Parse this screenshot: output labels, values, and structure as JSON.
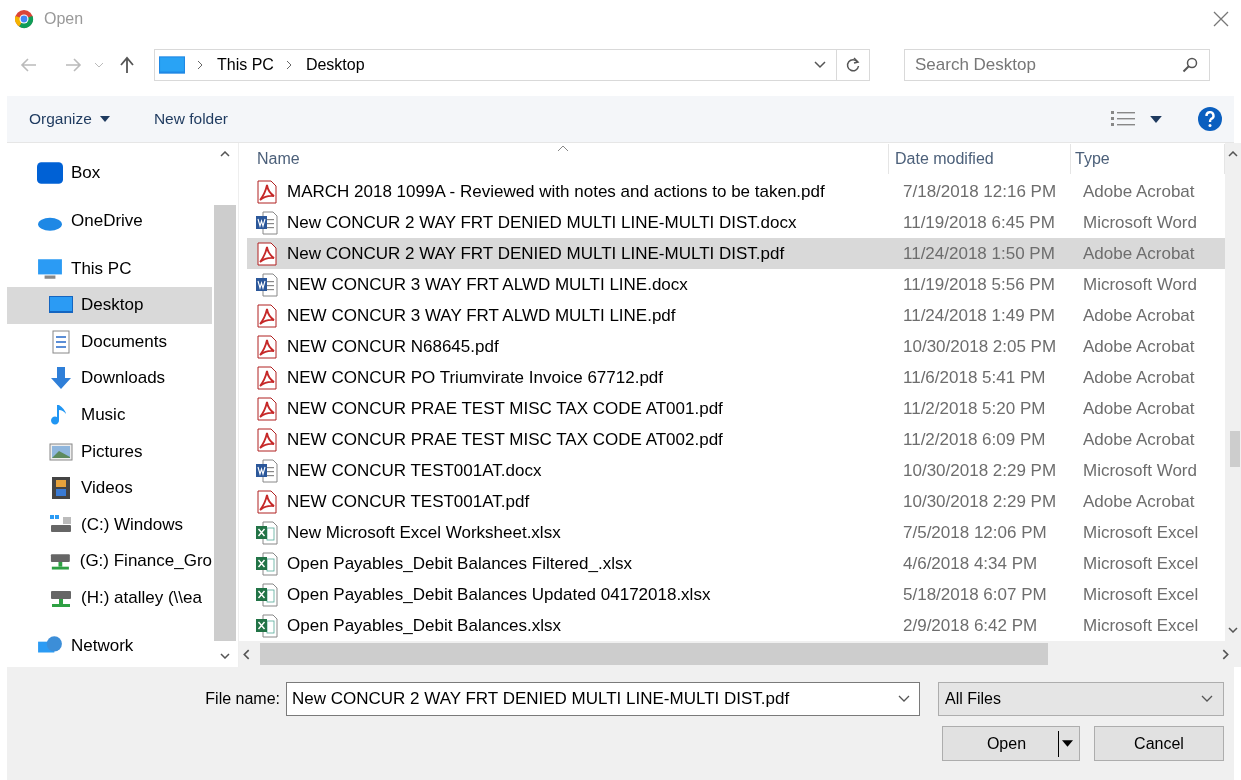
{
  "window": {
    "title": "Open"
  },
  "address": {
    "path": [
      "This PC",
      "Desktop"
    ]
  },
  "search": {
    "placeholder": "Search Desktop"
  },
  "toolbar": {
    "organize": "Organize",
    "new_folder": "New folder"
  },
  "sidebar": {
    "items": [
      {
        "label": "Box",
        "kind": "box",
        "selected": false
      },
      {
        "label": "OneDrive",
        "kind": "cloud",
        "selected": false
      },
      {
        "label": "This PC",
        "kind": "pc",
        "selected": false,
        "children": [
          {
            "label": "Desktop",
            "kind": "desktop",
            "selected": true
          },
          {
            "label": "Documents",
            "kind": "documents",
            "selected": false
          },
          {
            "label": "Downloads",
            "kind": "downloads",
            "selected": false
          },
          {
            "label": "Music",
            "kind": "music",
            "selected": false
          },
          {
            "label": "Pictures",
            "kind": "pictures",
            "selected": false
          },
          {
            "label": "Videos",
            "kind": "videos",
            "selected": false
          },
          {
            "label": "(C:) Windows",
            "kind": "drive",
            "selected": false
          },
          {
            "label": "(G:) Finance_Gro",
            "kind": "netdrive",
            "selected": false
          },
          {
            "label": "(H:) atalley (\\\\ea",
            "kind": "netdrive",
            "selected": false
          }
        ]
      },
      {
        "label": "Network",
        "kind": "network",
        "selected": false
      }
    ]
  },
  "table": {
    "columns": [
      "Name",
      "Date modified",
      "Type"
    ],
    "rows": [
      {
        "name": "MARCH 2018 1099A - Reviewed with notes and actions to be taken.pdf",
        "date": "7/18/2018 12:16 PM",
        "type": "Adobe Acrobat",
        "kind": "pdf",
        "selected": false
      },
      {
        "name": "New CONCUR 2 WAY FRT DENIED MULTI LINE-MULTI DIST.docx",
        "date": "11/19/2018 6:45 PM",
        "type": "Microsoft Word",
        "kind": "word",
        "selected": false
      },
      {
        "name": "New CONCUR 2 WAY FRT DENIED MULTI LINE-MULTI DIST.pdf",
        "date": "11/24/2018 1:50 PM",
        "type": "Adobe Acrobat",
        "kind": "pdf",
        "selected": true
      },
      {
        "name": "NEW CONCUR 3 WAY FRT ALWD MULTI LINE.docx",
        "date": "11/19/2018 5:56 PM",
        "type": "Microsoft Word",
        "kind": "word",
        "selected": false
      },
      {
        "name": "NEW CONCUR 3 WAY FRT ALWD MULTI LINE.pdf",
        "date": "11/24/2018 1:49 PM",
        "type": "Adobe Acrobat",
        "kind": "pdf",
        "selected": false
      },
      {
        "name": "NEW CONCUR N68645.pdf",
        "date": "10/30/2018 2:05 PM",
        "type": "Adobe Acrobat",
        "kind": "pdf",
        "selected": false
      },
      {
        "name": "NEW CONCUR PO Triumvirate Invoice 67712.pdf",
        "date": "11/6/2018 5:41 PM",
        "type": "Adobe Acrobat",
        "kind": "pdf",
        "selected": false
      },
      {
        "name": "NEW CONCUR PRAE TEST MISC TAX CODE AT001.pdf",
        "date": "11/2/2018 5:20 PM",
        "type": "Adobe Acrobat",
        "kind": "pdf",
        "selected": false
      },
      {
        "name": "NEW CONCUR PRAE TEST MISC TAX CODE AT002.pdf",
        "date": "11/2/2018 6:09 PM",
        "type": "Adobe Acrobat",
        "kind": "pdf",
        "selected": false
      },
      {
        "name": "NEW CONCUR TEST001AT.docx",
        "date": "10/30/2018 2:29 PM",
        "type": "Microsoft Word",
        "kind": "word",
        "selected": false
      },
      {
        "name": "NEW CONCUR TEST001AT.pdf",
        "date": "10/30/2018 2:29 PM",
        "type": "Adobe Acrobat",
        "kind": "pdf",
        "selected": false
      },
      {
        "name": "New Microsoft Excel Worksheet.xlsx",
        "date": "7/5/2018 12:06 PM",
        "type": "Microsoft Excel",
        "kind": "excel",
        "selected": false
      },
      {
        "name": "Open Payables_Debit Balances Filtered_.xlsx",
        "date": "4/6/2018 4:34 PM",
        "type": "Microsoft Excel",
        "kind": "excel",
        "selected": false
      },
      {
        "name": "Open Payables_Debit Balances Updated 04172018.xlsx",
        "date": "5/18/2018 6:07 PM",
        "type": "Microsoft Excel",
        "kind": "excel",
        "selected": false
      },
      {
        "name": "Open Payables_Debit Balances.xlsx",
        "date": "2/9/2018 6:42 PM",
        "type": "Microsoft Excel",
        "kind": "excel",
        "selected": false
      }
    ]
  },
  "footer": {
    "file_name_label": "File name:",
    "file_name": "New CONCUR 2 WAY FRT DENIED MULTI LINE-MULTI DIST.pdf",
    "file_type": "All Files",
    "open": "Open",
    "cancel": "Cancel"
  }
}
